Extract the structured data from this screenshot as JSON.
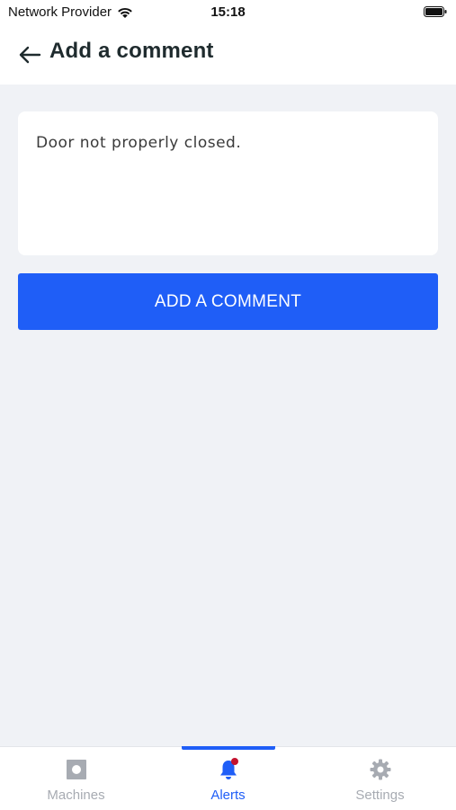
{
  "status_bar": {
    "carrier": "Network Provider",
    "time": "15:18"
  },
  "header": {
    "title": "Add a comment"
  },
  "comment": {
    "value": "Door not properly closed."
  },
  "actions": {
    "add_comment_label": "ADD A COMMENT"
  },
  "tab_bar": {
    "tabs": [
      {
        "label": "Machines",
        "icon": "machine-icon",
        "active": false
      },
      {
        "label": "Alerts",
        "icon": "bell-icon",
        "active": true,
        "has_badge": true
      },
      {
        "label": "Settings",
        "icon": "gear-icon",
        "active": false
      }
    ]
  },
  "colors": {
    "accent": "#1f5ef7",
    "background": "#f0f2f6",
    "inactive_tab": "#a7abb2",
    "badge": "#c4122f"
  }
}
